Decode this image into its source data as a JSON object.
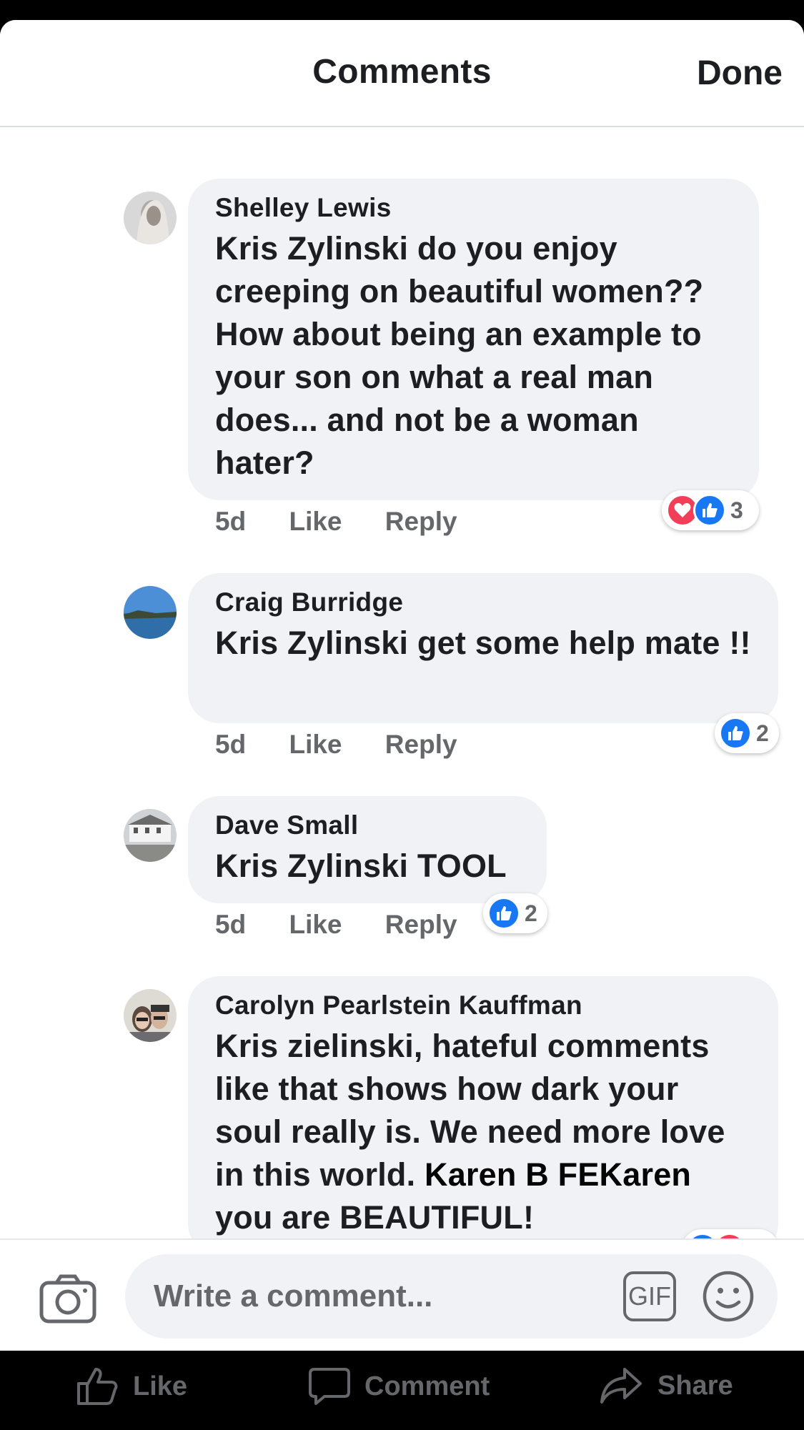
{
  "header": {
    "title": "Comments",
    "done_label": "Done"
  },
  "colors": {
    "bubble": "#f0f2f5",
    "muted": "#65676b",
    "like_blue": "#1877f2",
    "love_red": "#f33e58"
  },
  "comments": [
    {
      "author": "Shelley Lewis",
      "text": "Kris Zylinski do you enjoy creeping on beautiful women?? How about being an example to your son on what a real man does... and not be a woman hater?",
      "time": "5d",
      "like_label": "Like",
      "reply_label": "Reply",
      "reactions": [
        "love-icon",
        "like-icon"
      ],
      "reaction_count": "3"
    },
    {
      "author": "Craig Burridge",
      "text": "Kris Zylinski get some help mate !!",
      "time": "5d",
      "like_label": "Like",
      "reply_label": "Reply",
      "reactions": [
        "like-icon"
      ],
      "reaction_count": "2"
    },
    {
      "author": "Dave Small",
      "text": "Kris Zylinski TOOL",
      "time": "5d",
      "like_label": "Like",
      "reply_label": "Reply",
      "reactions": [
        "like-icon"
      ],
      "reaction_count": "2"
    },
    {
      "author": "Carolyn Pearlstein Kauffman",
      "text": "Kris zielinski, hateful comments like that shows how dark your soul really is. We need more love in this world.",
      "mention": "Karen B FEKaren",
      "text_after": "you are BEAUTIFUL!"
    }
  ],
  "composer": {
    "placeholder": "Write a comment...",
    "gif_label": "GIF"
  },
  "actions": {
    "like": "Like",
    "comment": "Comment",
    "share": "Share"
  }
}
